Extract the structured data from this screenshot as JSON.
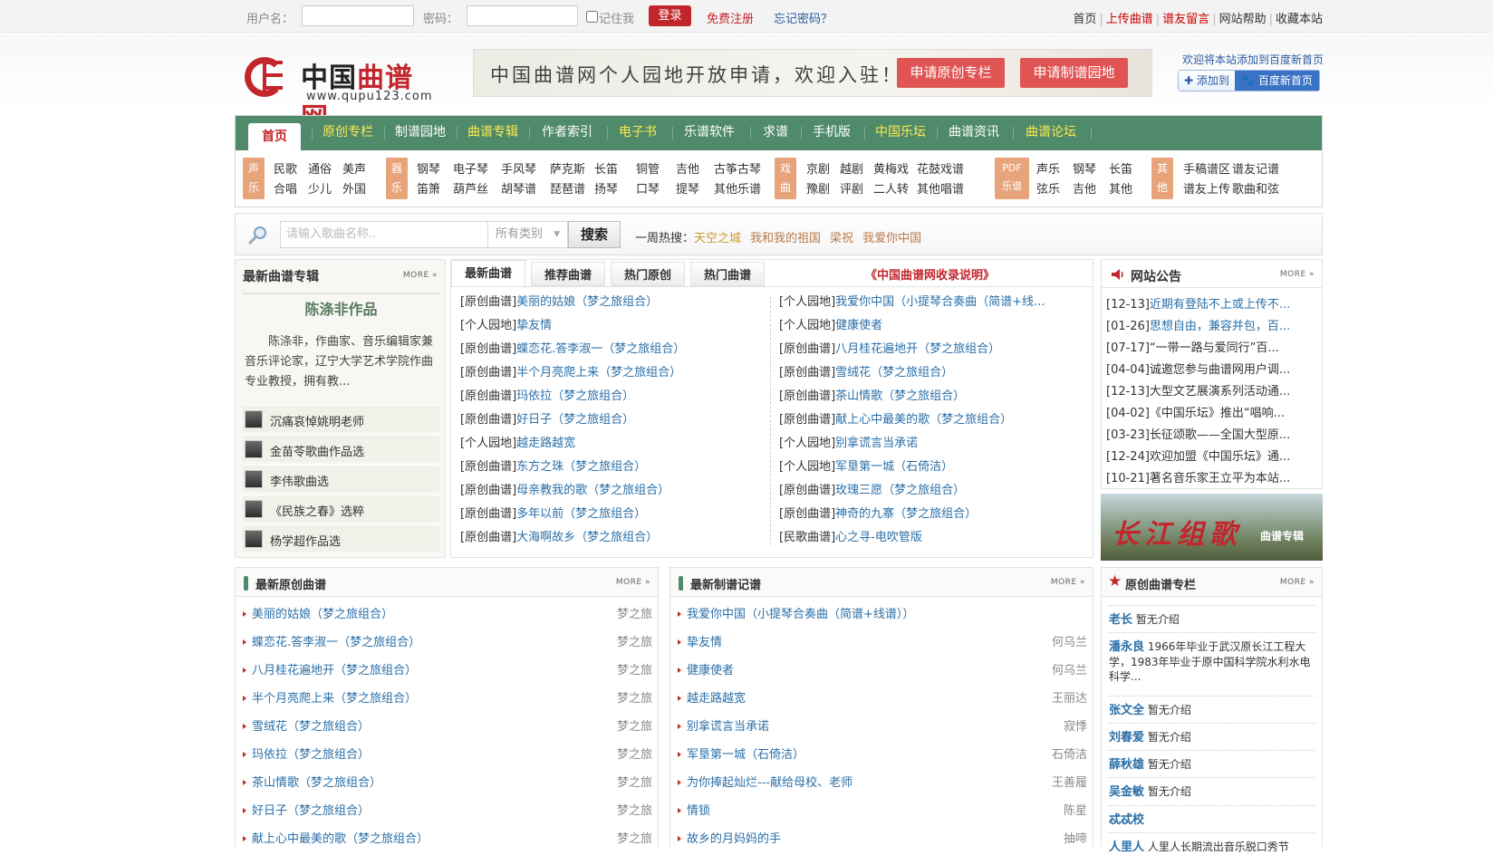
{
  "topbar": {
    "username_label": "用户名：",
    "password_label": "密码：",
    "remember_label": "记住我",
    "login_label": "登录",
    "register": "免费注册",
    "forgot": "忘记密码？",
    "links": [
      {
        "label": "首页",
        "red": false
      },
      {
        "label": "上传曲谱",
        "red": true
      },
      {
        "label": "谱友留言",
        "red": true
      },
      {
        "label": "网站帮助",
        "red": false
      },
      {
        "label": "收藏本站",
        "red": false
      }
    ]
  },
  "header": {
    "logo_cn_1": "中国",
    "logo_cn_2": "曲谱网",
    "logo_url": "www.qupu123.com",
    "banner_text": "中国曲谱网个人园地开放申请，欢迎入驻！",
    "banner_btn1": "申请原创专栏",
    "banner_btn2": "申请制谱园地",
    "welcome": "欢迎将本站添加到百度新首页",
    "add_label": "添加到",
    "baidu_label": "百度新首页"
  },
  "nav": {
    "items": [
      "首页",
      "原创专栏",
      "制谱园地",
      "曲谱专辑",
      "作者索引",
      "电子书",
      "乐谱软件",
      "求谱",
      "手机版",
      "中国乐坛",
      "曲谱资讯",
      "曲谱论坛"
    ]
  },
  "cats": {
    "vocal_badge": "声乐",
    "vocal": [
      "民歌",
      "通俗",
      "美声",
      "合唱",
      "少儿",
      "外国"
    ],
    "inst_badge": "器乐",
    "inst": [
      "钢琴",
      "电子琴",
      "手风琴",
      "萨克斯",
      "长笛",
      "铜管",
      "吉他",
      "古筝古琴",
      "笛箫",
      "葫芦丝",
      "胡琴谱",
      "琵琶谱",
      "扬琴",
      "口琴",
      "提琴",
      "其他乐谱"
    ],
    "opera_badge": "戏曲",
    "opera": [
      "京剧",
      "越剧",
      "黄梅戏",
      "花鼓戏谱",
      "豫剧",
      "评剧",
      "二人转",
      "其他唱谱"
    ],
    "pdf_badge": "PDF乐谱",
    "pdf": [
      "声乐",
      "钢琴",
      "长笛",
      "弦乐",
      "吉他",
      "其他"
    ],
    "other_badge": "其他",
    "other": [
      "手稿谱区",
      "谱友记谱",
      "谱友上传",
      "歌曲和弦"
    ]
  },
  "search": {
    "placeholder": "请输入歌曲名称..",
    "category": "所有类别",
    "button": "搜索",
    "hot_label": "一周热搜：",
    "hot": [
      "天空之城",
      "我和我的祖国",
      "梁祝",
      "我爱你中国"
    ]
  },
  "left": {
    "title": "最新曲谱专辑",
    "more": "MORE »",
    "author": "陈涤非作品",
    "desc": "陈涤非，作曲家、音乐编辑家兼音乐评论家，辽宁大学艺术学院作曲专业教授，拥有教...",
    "albums": [
      "沉痛哀悼姚明老师",
      "金苗苓歌曲作品选",
      "李伟歌曲选",
      "《民族之春》选粹",
      "杨学超作品选"
    ]
  },
  "center": {
    "tabs": [
      "最新曲谱",
      "推荐曲谱",
      "热门原创",
      "热门曲谱"
    ],
    "link": "《中国曲谱网收录说明》",
    "left_list": [
      [
        "[原创曲谱]",
        "美丽的姑娘（梦之旅组合）"
      ],
      [
        "[个人园地]",
        "挚友情"
      ],
      [
        "[原创曲谱]",
        "蝶恋花.答李淑一（梦之旅组合）"
      ],
      [
        "[原创曲谱]",
        "半个月亮爬上来（梦之旅组合）"
      ],
      [
        "[原创曲谱]",
        "玛依拉（梦之旅组合）"
      ],
      [
        "[原创曲谱]",
        "好日子（梦之旅组合）"
      ],
      [
        "[个人园地]",
        "越走路越宽"
      ],
      [
        "[原创曲谱]",
        "东方之珠（梦之旅组合）"
      ],
      [
        "[原创曲谱]",
        "母亲教我的歌（梦之旅组合）"
      ],
      [
        "[原创曲谱]",
        "多年以前（梦之旅组合）"
      ],
      [
        "[原创曲谱]",
        "大海啊故乡（梦之旅组合）"
      ]
    ],
    "right_list": [
      [
        "[个人园地]",
        "我爱你中国（小提琴合奏曲（简谱+线..."
      ],
      [
        "[个人园地]",
        "健康使者"
      ],
      [
        "[原创曲谱]",
        "八月桂花遍地开（梦之旅组合）"
      ],
      [
        "[原创曲谱]",
        "雪绒花（梦之旅组合）"
      ],
      [
        "[原创曲谱]",
        "茶山情歌（梦之旅组合）"
      ],
      [
        "[原创曲谱]",
        "献上心中最美的歌（梦之旅组合）"
      ],
      [
        "[个人园地]",
        "别拿谎言当承诺"
      ],
      [
        "[个人园地]",
        "军垦第一城（石倚洁）"
      ],
      [
        "[原创曲谱]",
        "玫瑰三愿（梦之旅组合）"
      ],
      [
        "[原创曲谱]",
        "神奇的九寨（梦之旅组合）"
      ],
      [
        "[民歌曲谱]",
        "心之寻-电吹管版"
      ]
    ]
  },
  "notice": {
    "title": "网站公告",
    "more": "MORE »",
    "items": [
      [
        "[12-13]",
        "近期有登陆不上或上传不..."
      ],
      [
        "[01-26]",
        "思想自由，兼容并包，百..."
      ],
      [
        "[07-17]",
        "“一带一路与爱同行”百..."
      ],
      [
        "[04-04]",
        "诚邀您参与曲谱网用户调..."
      ],
      [
        "[12-13]",
        "大型文艺展演系列活动通..."
      ],
      [
        "[04-02]",
        "《中国乐坛》推出“唱响..."
      ],
      [
        "[03-23]",
        "长征颂歌——全国大型原..."
      ],
      [
        "[12-24]",
        "欢迎加盟《中国乐坛》通..."
      ],
      [
        "[10-21]",
        "著名音乐家王立平为本站..."
      ]
    ]
  },
  "promo": {
    "title": "长江组歌",
    "sub": "曲谱专辑"
  },
  "original": {
    "title": "最新原创曲谱",
    "more": "MORE »",
    "items": [
      [
        "美丽的姑娘（梦之旅组合）",
        "梦之旅"
      ],
      [
        "蝶恋花.答李淑一（梦之旅组合）",
        "梦之旅"
      ],
      [
        "八月桂花遍地开（梦之旅组合）",
        "梦之旅"
      ],
      [
        "半个月亮爬上来（梦之旅组合）",
        "梦之旅"
      ],
      [
        "雪绒花（梦之旅组合）",
        "梦之旅"
      ],
      [
        "玛依拉（梦之旅组合）",
        "梦之旅"
      ],
      [
        "茶山情歌（梦之旅组合）",
        "梦之旅"
      ],
      [
        "好日子（梦之旅组合）",
        "梦之旅"
      ],
      [
        "献上心中最美的歌（梦之旅组合）",
        "梦之旅"
      ]
    ]
  },
  "notation": {
    "title": "最新制谱记谱",
    "more": "MORE »",
    "items": [
      [
        "我爱你中国（小提琴合奏曲（简谱+线谱））",
        ""
      ],
      [
        "挚友情",
        "何乌兰"
      ],
      [
        "健康使者",
        "何乌兰"
      ],
      [
        "越走路越宽",
        "王丽达"
      ],
      [
        "别拿谎言当承诺",
        "寂悸"
      ],
      [
        "军垦第一城（石倚洁）",
        "石倚洁"
      ],
      [
        "为你捧起灿烂---献给母校、老师",
        "王善履"
      ],
      [
        "情锁",
        "陈星"
      ],
      [
        "故乡的月妈妈的手",
        "抽啼"
      ]
    ]
  },
  "columns": {
    "title": "原创曲谱专栏",
    "more": "MORE »",
    "items": [
      [
        "老长",
        "暂无介绍"
      ],
      [
        "潘永良",
        "1966年毕业于武汉原长江工程大学，1983年毕业于原中国科学院水利水电科学..."
      ],
      [
        "张文全",
        "暂无介绍"
      ],
      [
        "刘春爱",
        "暂无介绍"
      ],
      [
        "薛秋雄",
        "暂无介绍"
      ],
      [
        "吴金敏",
        "暂无介绍"
      ],
      [
        "忒忒校",
        ""
      ],
      [
        "人里人",
        "人里人长期流出音乐脱口秀节"
      ]
    ]
  }
}
